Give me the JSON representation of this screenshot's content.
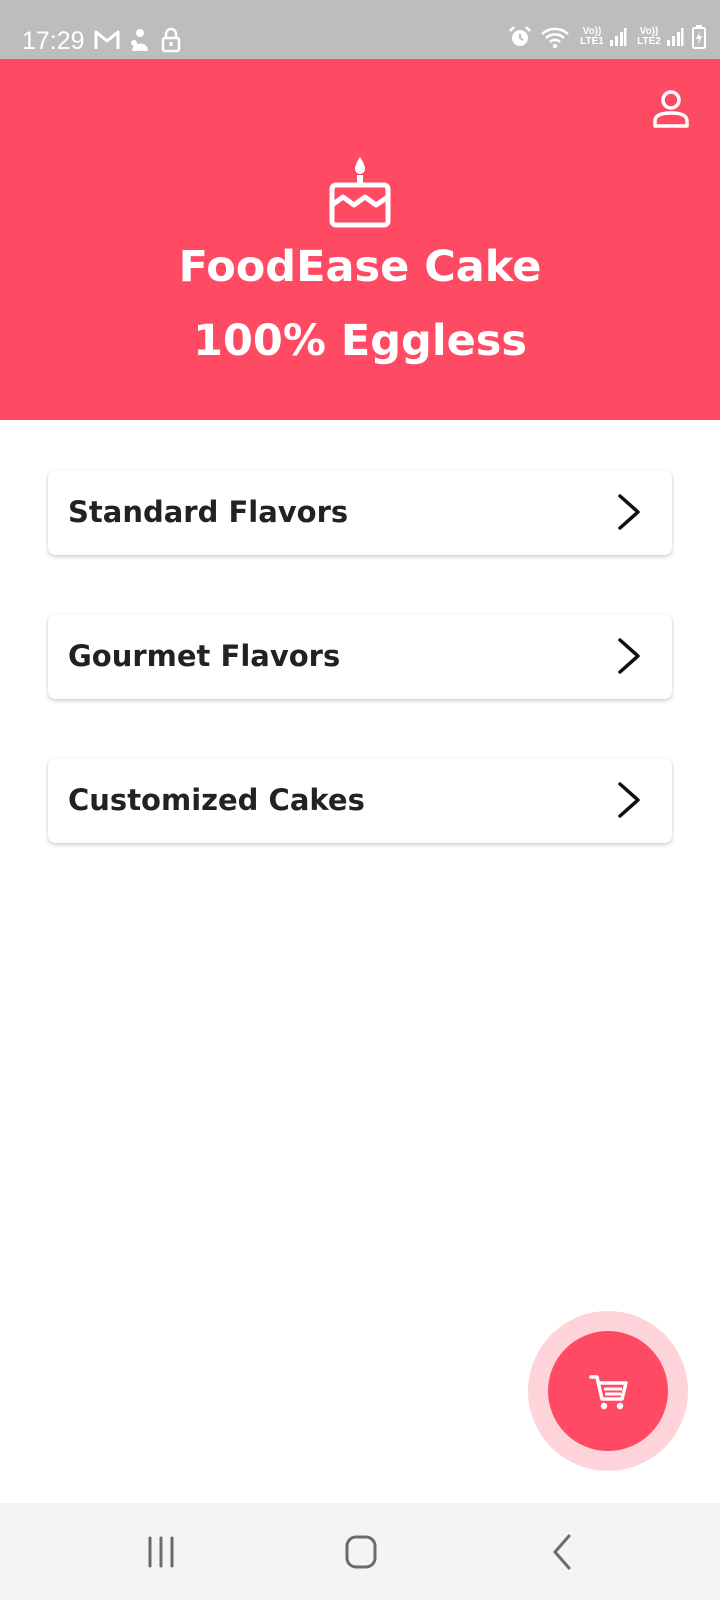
{
  "status_bar": {
    "time": "17:29",
    "left_icons": [
      "gmail-icon",
      "notification-icon",
      "lock-icon"
    ],
    "right_icons": [
      "alarm-icon",
      "wifi-icon",
      "signal-icon",
      "signal-icon",
      "battery-icon"
    ],
    "sim1_label": "Vo)) LTE1",
    "sim2_label": "Vo)) LTE2",
    "background_color": "#bdbdbd"
  },
  "header": {
    "title": "FoodEase Cake",
    "subtitle": "100% Eggless",
    "icon": "cake-icon",
    "profile_icon": "user-icon",
    "background_color": "#fe4a62"
  },
  "categories": [
    {
      "label": "Standard Flavors",
      "icon": "chevron-right-icon"
    },
    {
      "label": "Gourmet Flavors",
      "icon": "chevron-right-icon"
    },
    {
      "label": "Customized Cakes",
      "icon": "chevron-right-icon"
    }
  ],
  "cart_button": {
    "icon": "cart-icon",
    "color": "#fe4a62",
    "halo_color": "#ffd3da"
  },
  "nav_bar": {
    "buttons": [
      "recent-apps-icon",
      "home-icon",
      "back-icon"
    ]
  }
}
